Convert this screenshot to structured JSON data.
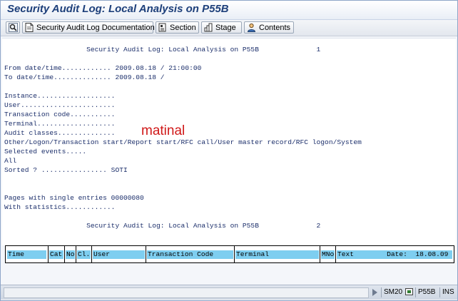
{
  "window": {
    "title": "Security Audit Log: Local Analysis on P55B"
  },
  "toolbar": {
    "buttons": [
      {
        "label": ""
      },
      {
        "label": "Security Audit Log Documentation"
      },
      {
        "label": "Section"
      },
      {
        "label": "Stage"
      },
      {
        "label": "Contents"
      }
    ]
  },
  "report": {
    "lines": [
      "                    Security Audit Log: Local Analysis on P55B              1",
      "",
      "From date/time............ 2009.08.18 / 21:00:00",
      "To date/time.............. 2009.08.18 /",
      "",
      "Instance...................",
      "User.......................",
      "Transaction code...........",
      "Terminal...................",
      "Audit classes..............",
      "Other/Logon/Transaction start/Report start/RFC call/User master record/RFC logon/System",
      "Selected events.....",
      "All",
      "Sorted ? ................ SOTI",
      "",
      "",
      "Pages with single entries 00000080",
      "With statistics............",
      "",
      "                    Security Audit Log: Local Analysis on P55B              2"
    ],
    "annotation": "matinal"
  },
  "table": {
    "headers": [
      "Time",
      "Cat",
      "No",
      "Cl.",
      "User",
      "Transaction Code",
      "Terminal",
      "MNo",
      "Text        Date:  18.08.09"
    ]
  },
  "status": {
    "tcode": "SM20",
    "system": "P55B",
    "mode": "INS"
  },
  "colors": {
    "title": "#1d3f7a",
    "report_text": "#1c2f6b",
    "header_fill": "#7ecef0",
    "annotation": "#d01818"
  }
}
